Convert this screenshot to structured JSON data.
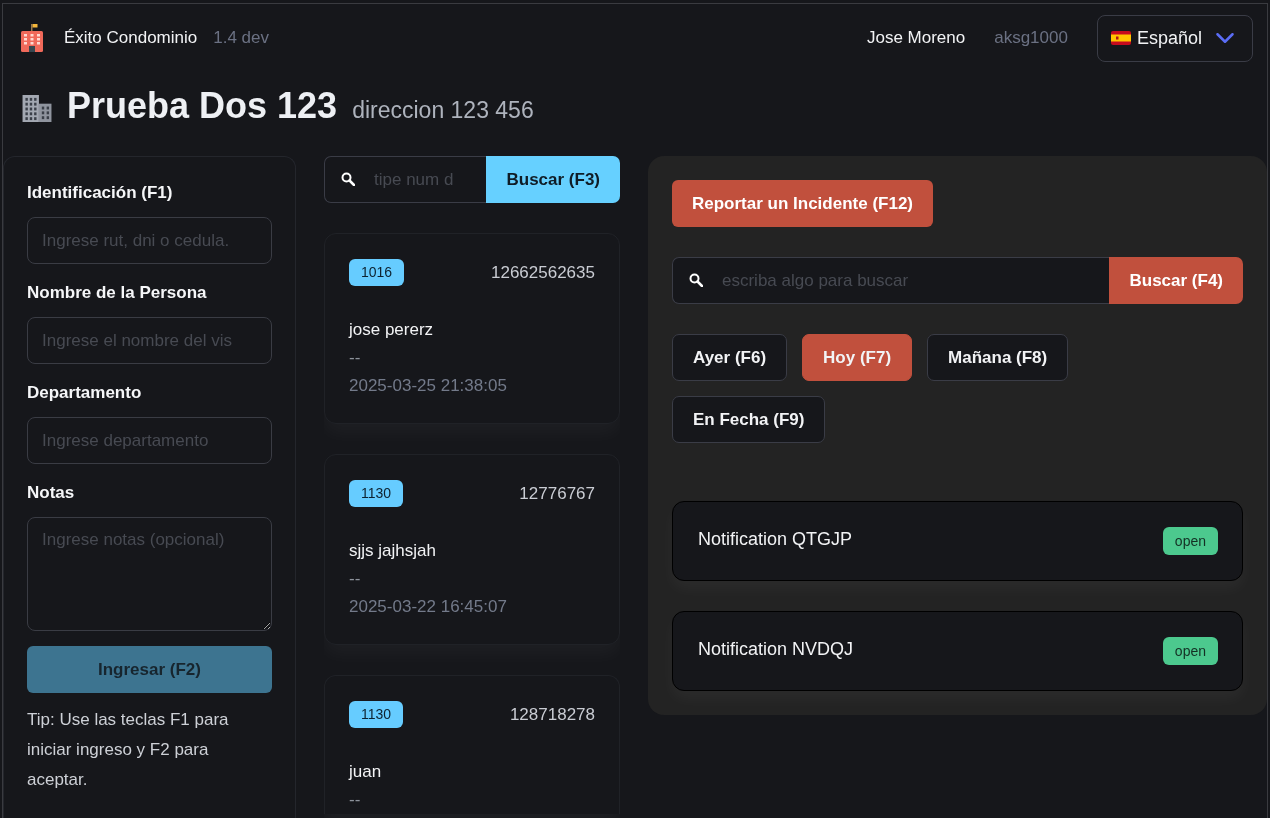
{
  "header": {
    "app_name": "Éxito Condominio",
    "version": "1.4 dev",
    "user_name": "Jose Moreno",
    "user_code": "aksg1000",
    "language": "Español"
  },
  "title": {
    "name": "Prueba Dos 123",
    "address": "direccion 123 456"
  },
  "entry_form": {
    "fields": [
      {
        "kind": "input",
        "label": "Identificación (F1)",
        "placeholder": "Ingrese rut, dni o cedula."
      },
      {
        "kind": "input",
        "label": "Nombre de la Persona",
        "placeholder": "Ingrese el nombre del vis"
      },
      {
        "kind": "input",
        "label": "Departamento",
        "placeholder": "Ingrese departamento"
      },
      {
        "kind": "textarea",
        "label": "Notas",
        "placeholder": "Ingrese notas (opcional)"
      }
    ],
    "submit": "Ingresar (F2)",
    "tip": "Tip: Use las teclas F1 para iniciar ingreso y F2 para aceptar."
  },
  "visits": {
    "search": {
      "placeholder": "tipe num d",
      "button": "Buscar (F3)"
    },
    "cards": [
      {
        "unit": "1016",
        "document": "12662562635",
        "name": "jose pererz",
        "notes": "--",
        "timestamp": "2025-03-25 21:38:05"
      },
      {
        "unit": "1130",
        "document": "12776767",
        "name": "sjjs jajhsjah",
        "notes": "--",
        "timestamp": "2025-03-22 16:45:07"
      },
      {
        "unit": "1130",
        "document": "128718278",
        "name": "juan",
        "notes": "--"
      }
    ]
  },
  "incidents": {
    "report_button": "Reportar un Incidente (F12)",
    "search": {
      "placeholder": "escriba algo para buscar",
      "button": "Buscar (F4)"
    },
    "filters": [
      {
        "label": "Ayer (F6)",
        "selected": false
      },
      {
        "label": "Hoy (F7)",
        "selected": true
      },
      {
        "label": "Mañana (F8)",
        "selected": false
      },
      {
        "label": "En Fecha (F9)",
        "selected": false
      }
    ],
    "notifications": [
      {
        "title": "Notification QTGJP",
        "status": "open"
      },
      {
        "title": "Notification NVDQJ",
        "status": "open"
      }
    ]
  }
}
